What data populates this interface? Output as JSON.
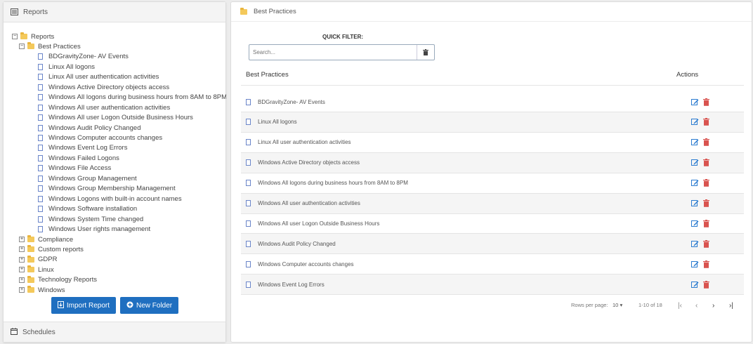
{
  "left_panel": {
    "title": "Reports",
    "tree": [
      {
        "label": "Reports",
        "level": 0,
        "kind": "folder",
        "expanded": true
      },
      {
        "label": "Best Practices",
        "level": 1,
        "kind": "folder",
        "expanded": true
      },
      {
        "label": "BDGravityZone- AV Events",
        "level": 2,
        "kind": "report"
      },
      {
        "label": "Linux All logons",
        "level": 2,
        "kind": "report"
      },
      {
        "label": "Linux All user authentication activities",
        "level": 2,
        "kind": "report"
      },
      {
        "label": "Windows Active Directory objects access",
        "level": 2,
        "kind": "report"
      },
      {
        "label": "Windows All logons during business hours from 8AM to 8PM",
        "level": 2,
        "kind": "report"
      },
      {
        "label": "Windows All user authentication activities",
        "level": 2,
        "kind": "report"
      },
      {
        "label": "Windows All user Logon Outside Business Hours",
        "level": 2,
        "kind": "report"
      },
      {
        "label": "Windows Audit Policy Changed",
        "level": 2,
        "kind": "report"
      },
      {
        "label": "Windows Computer accounts changes",
        "level": 2,
        "kind": "report"
      },
      {
        "label": "Windows Event Log Errors",
        "level": 2,
        "kind": "report"
      },
      {
        "label": "Windows Failed Logons",
        "level": 2,
        "kind": "report"
      },
      {
        "label": "Windows File Access",
        "level": 2,
        "kind": "report"
      },
      {
        "label": "Windows Group Management",
        "level": 2,
        "kind": "report"
      },
      {
        "label": "Windows Group Membership Management",
        "level": 2,
        "kind": "report"
      },
      {
        "label": "Windows Logons with built-in account names",
        "level": 2,
        "kind": "report"
      },
      {
        "label": "Windows Software installation",
        "level": 2,
        "kind": "report"
      },
      {
        "label": "Windows System Time changed",
        "level": 2,
        "kind": "report"
      },
      {
        "label": "Windows User rights management",
        "level": 2,
        "kind": "report"
      },
      {
        "label": "Compliance",
        "level": 1,
        "kind": "folder",
        "expanded": false
      },
      {
        "label": "Custom reports",
        "level": 1,
        "kind": "folder",
        "expanded": false
      },
      {
        "label": "GDPR",
        "level": 1,
        "kind": "folder",
        "expanded": false
      },
      {
        "label": "Linux",
        "level": 1,
        "kind": "folder",
        "expanded": false
      },
      {
        "label": "Technology Reports",
        "level": 1,
        "kind": "folder",
        "expanded": false
      },
      {
        "label": "Windows",
        "level": 1,
        "kind": "folder",
        "expanded": false
      }
    ],
    "import_button": "Import Report",
    "new_folder_button": "New Folder",
    "schedules": "Schedules"
  },
  "right_panel": {
    "title": "Best Practices",
    "quick_filter_label": "QUICK FILTER:",
    "search_placeholder": "Search...",
    "col_name": "Best Practices",
    "col_actions": "Actions",
    "rows": [
      "BDGravityZone- AV Events",
      "Linux All logons",
      "Linux All user authentication activities",
      "Windows Active Directory objects access",
      "Windows All logons during business hours from 8AM to 8PM",
      "Windows All user authentication activities",
      "Windows All user Logon Outside Business Hours",
      "Windows Audit Policy Changed",
      "Windows Computer accounts changes",
      "Windows Event Log Errors"
    ],
    "rows_per_page_label": "Rows per page:",
    "rows_per_page_value": "10",
    "range_text": "1-10 of 18"
  },
  "colors": {
    "accent": "#1f6fc0",
    "folder": "#f4c95b",
    "edit": "#2a7bd0",
    "delete": "#d9534f"
  }
}
